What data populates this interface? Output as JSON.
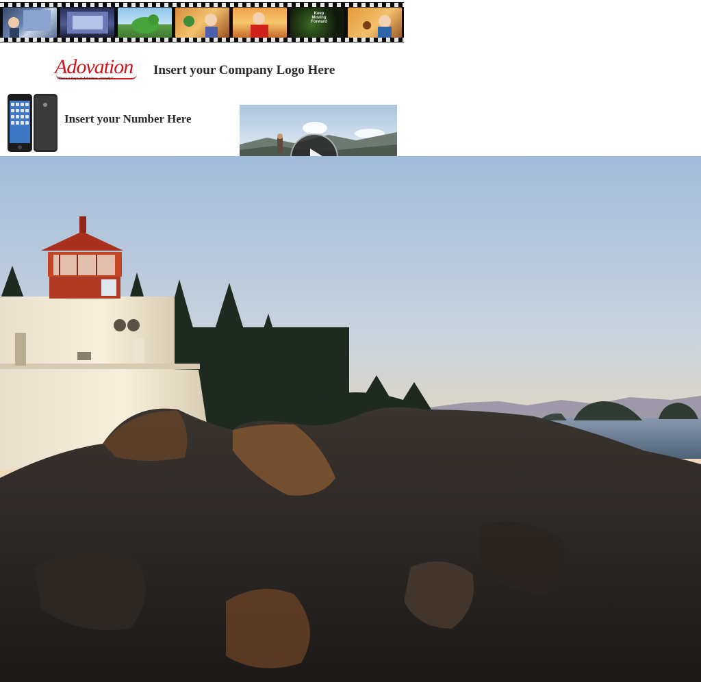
{
  "header": {
    "company_logo_text": "Insert your Company Logo Here",
    "number_text": "Insert your Number Here"
  },
  "logo": {
    "wordmark": "Adovation",
    "tagline": "\"Where it Pays to Advertise, Literally!\""
  },
  "filmstrip": {
    "frame_poster_text": "Keep Moving Forward"
  },
  "colors": {
    "brand_red": "#d1141b",
    "text": "#2a2a2a",
    "film_black": "#0c0c0c"
  },
  "icons": {
    "video_play": "play-icon"
  }
}
